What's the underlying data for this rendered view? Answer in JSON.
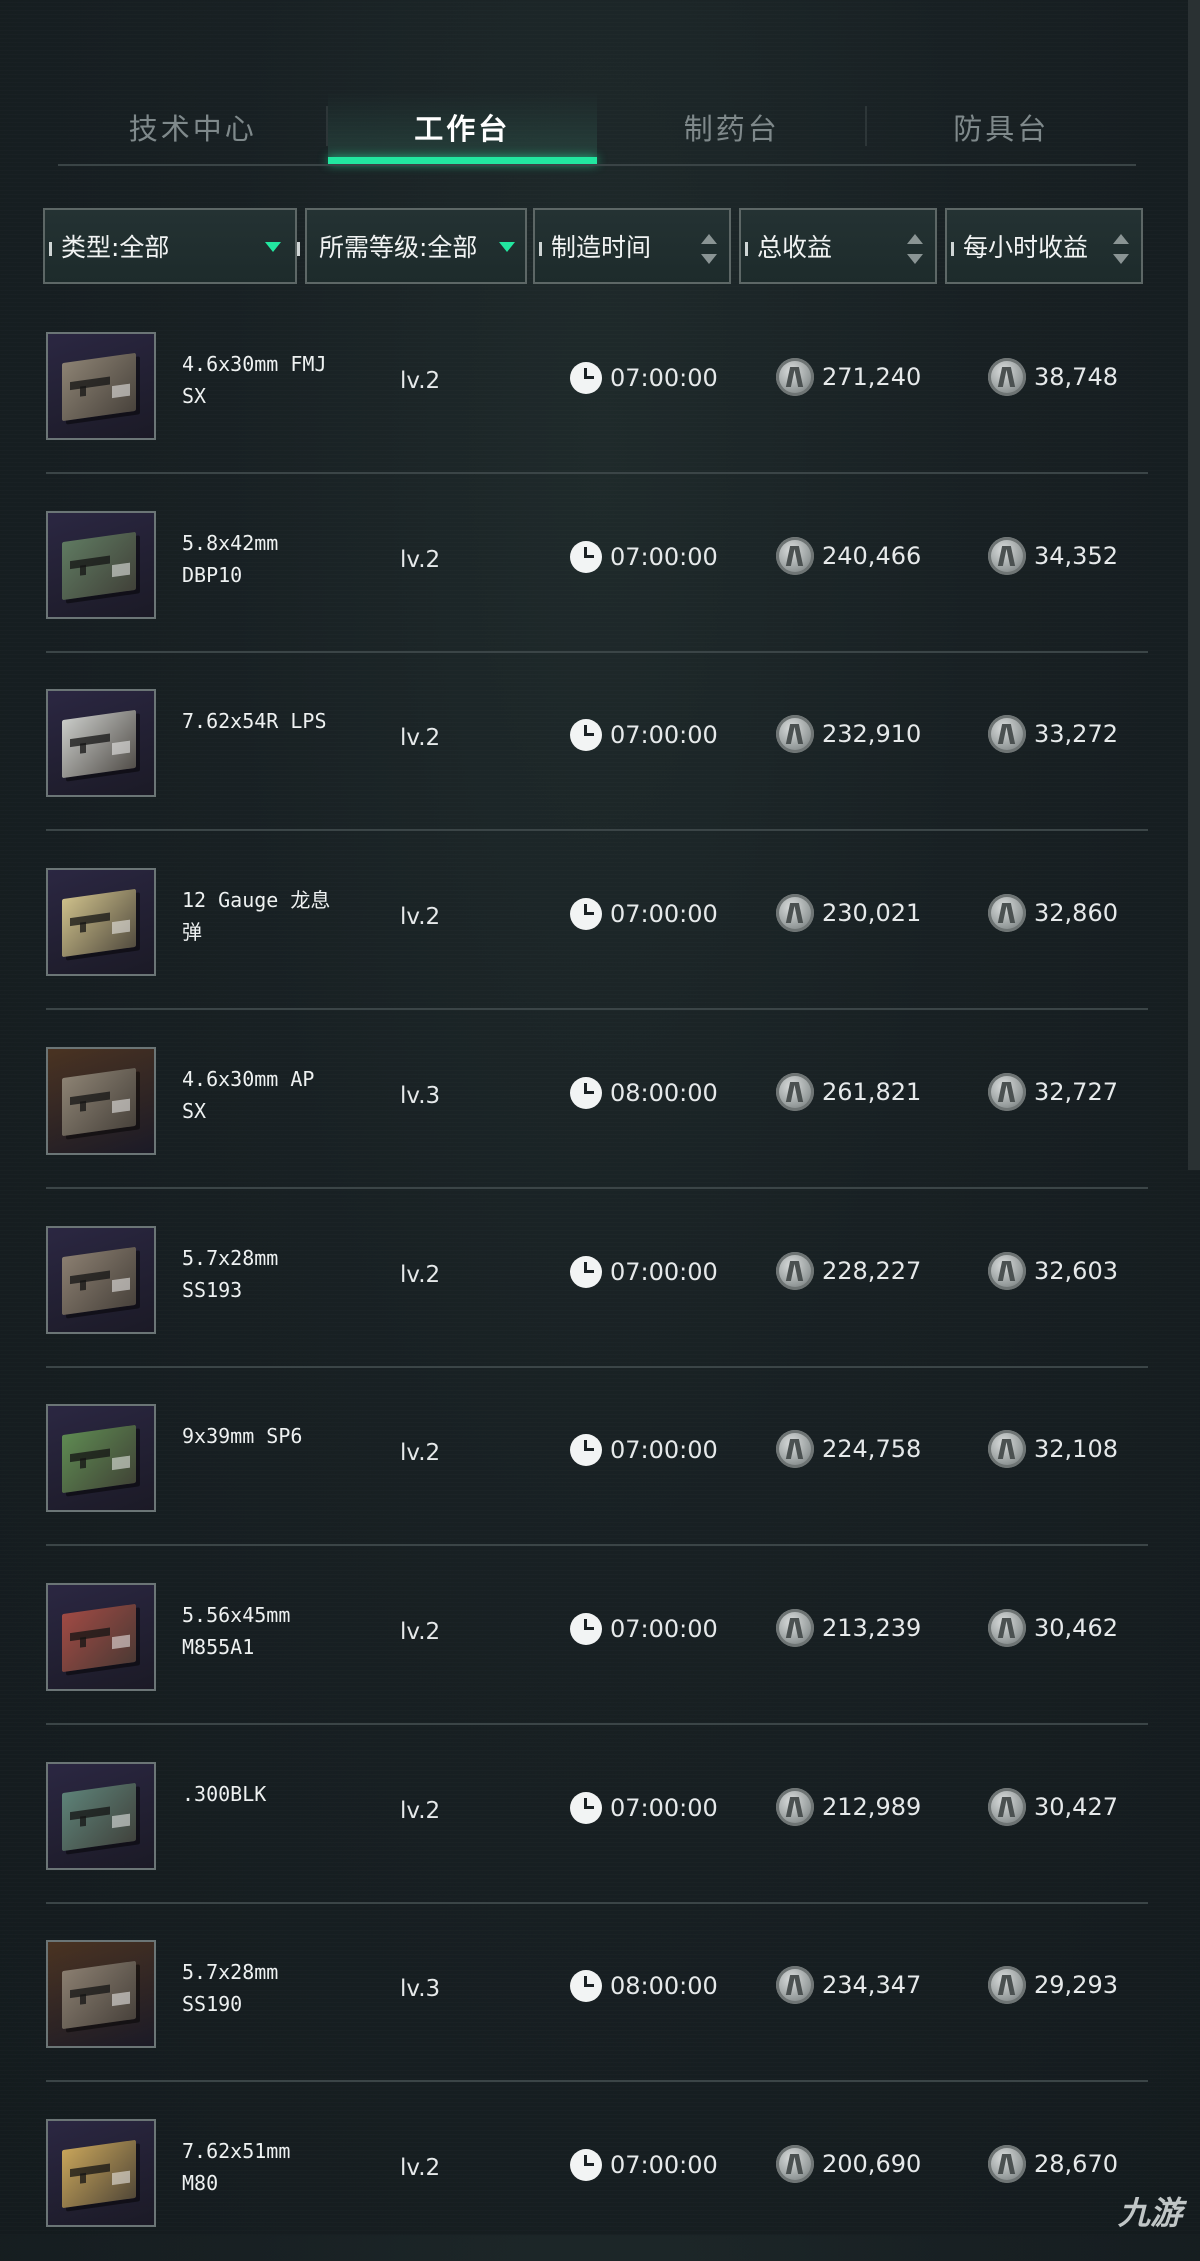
{
  "tabs": [
    {
      "label": "技术中心",
      "active": false
    },
    {
      "label": "工作台",
      "active": true
    },
    {
      "label": "制药台",
      "active": false
    },
    {
      "label": "防具台",
      "active": false
    }
  ],
  "filters": {
    "type": "类型:全部",
    "level": "所需等级:全部",
    "craft_time": "制造时间",
    "total_profit": "总收益",
    "hourly_profit": "每小时收益"
  },
  "colors": {
    "accent": "#22e7a0"
  },
  "icons": {
    "time": "clock-icon",
    "currency": "coin-icon",
    "dropdown": "triangle-down-icon",
    "sort": "sort-arrows-icon"
  },
  "items": [
    {
      "name": "4.6x30mm FMJ SX",
      "level": "lv.2",
      "time": "07:00:00",
      "total": "271,240",
      "hourly": "38,748",
      "box_color": "#8c8273",
      "thumb_bg": "#2b2742"
    },
    {
      "name": "5.8x42mm DBP10",
      "level": "lv.2",
      "time": "07:00:00",
      "total": "240,466",
      "hourly": "34,352",
      "box_color": "#5f7a61",
      "thumb_bg": "#2b2742"
    },
    {
      "name": "7.62x54R LPS",
      "level": "lv.2",
      "time": "07:00:00",
      "total": "232,910",
      "hourly": "33,272",
      "box_color": "#c9cbc8",
      "thumb_bg": "#2b2742"
    },
    {
      "name": "12 Gauge 龙息弹",
      "level": "lv.2",
      "time": "07:00:00",
      "total": "230,021",
      "hourly": "32,860",
      "box_color": "#cdbf8a",
      "thumb_bg": "#2b2742"
    },
    {
      "name": "4.6x30mm AP SX",
      "level": "lv.3",
      "time": "08:00:00",
      "total": "261,821",
      "hourly": "32,727",
      "box_color": "#8c8273",
      "thumb_bg": "#4a3322"
    },
    {
      "name": "5.7x28mm SS193",
      "level": "lv.2",
      "time": "07:00:00",
      "total": "228,227",
      "hourly": "32,603",
      "box_color": "#8a7e70",
      "thumb_bg": "#2b2742"
    },
    {
      "name": "9x39mm SP6",
      "level": "lv.2",
      "time": "07:00:00",
      "total": "224,758",
      "hourly": "32,108",
      "box_color": "#5e8a52",
      "thumb_bg": "#2b2742"
    },
    {
      "name": "5.56x45mm M855A1",
      "level": "lv.2",
      "time": "07:00:00",
      "total": "213,239",
      "hourly": "30,462",
      "box_color": "#a04a44",
      "thumb_bg": "#2b2742"
    },
    {
      "name": ".300BLK",
      "level": "lv.2",
      "time": "07:00:00",
      "total": "212,989",
      "hourly": "30,427",
      "box_color": "#5d8278",
      "thumb_bg": "#2b2742"
    },
    {
      "name": "5.7x28mm SS190",
      "level": "lv.3",
      "time": "08:00:00",
      "total": "234,347",
      "hourly": "29,293",
      "box_color": "#8a7e70",
      "thumb_bg": "#4a3322"
    },
    {
      "name": "7.62x51mm M80",
      "level": "lv.2",
      "time": "07:00:00",
      "total": "200,690",
      "hourly": "28,670",
      "box_color": "#c7a45a",
      "thumb_bg": "#2b2742"
    }
  ],
  "watermark": "九游"
}
